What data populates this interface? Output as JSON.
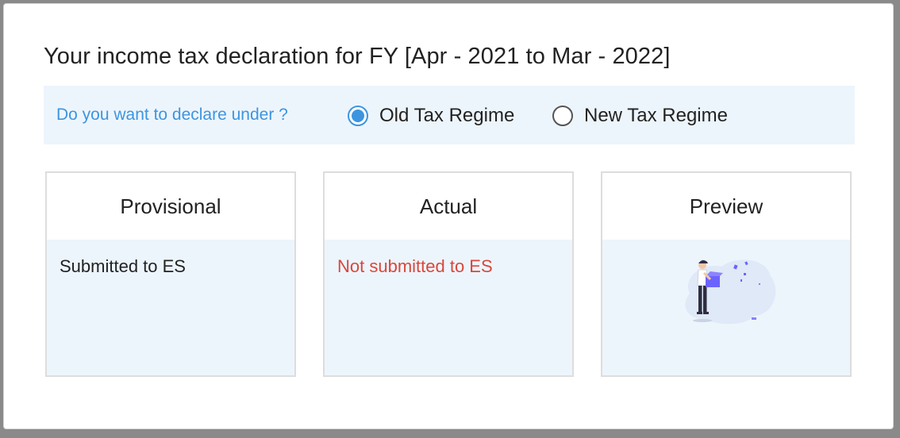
{
  "dialog": {
    "title": "Your income tax declaration for FY [Apr - 2021 to Mar - 2022]"
  },
  "regime": {
    "question": "Do you want to declare under ?",
    "options": [
      {
        "label": "Old Tax Regime",
        "selected": true
      },
      {
        "label": "New Tax Regime",
        "selected": false
      }
    ]
  },
  "cards": [
    {
      "title": "Provisional",
      "status": "Submitted to ES"
    },
    {
      "title": "Actual",
      "status": "Not submitted to ES"
    },
    {
      "title": "Preview",
      "illustration": "person-holding-box-illustration"
    }
  ],
  "colors": {
    "accent": "#3d95e0",
    "panel_bg": "#edf5fc",
    "error": "#d9473a",
    "illustration_purple": "#6c63ff"
  }
}
